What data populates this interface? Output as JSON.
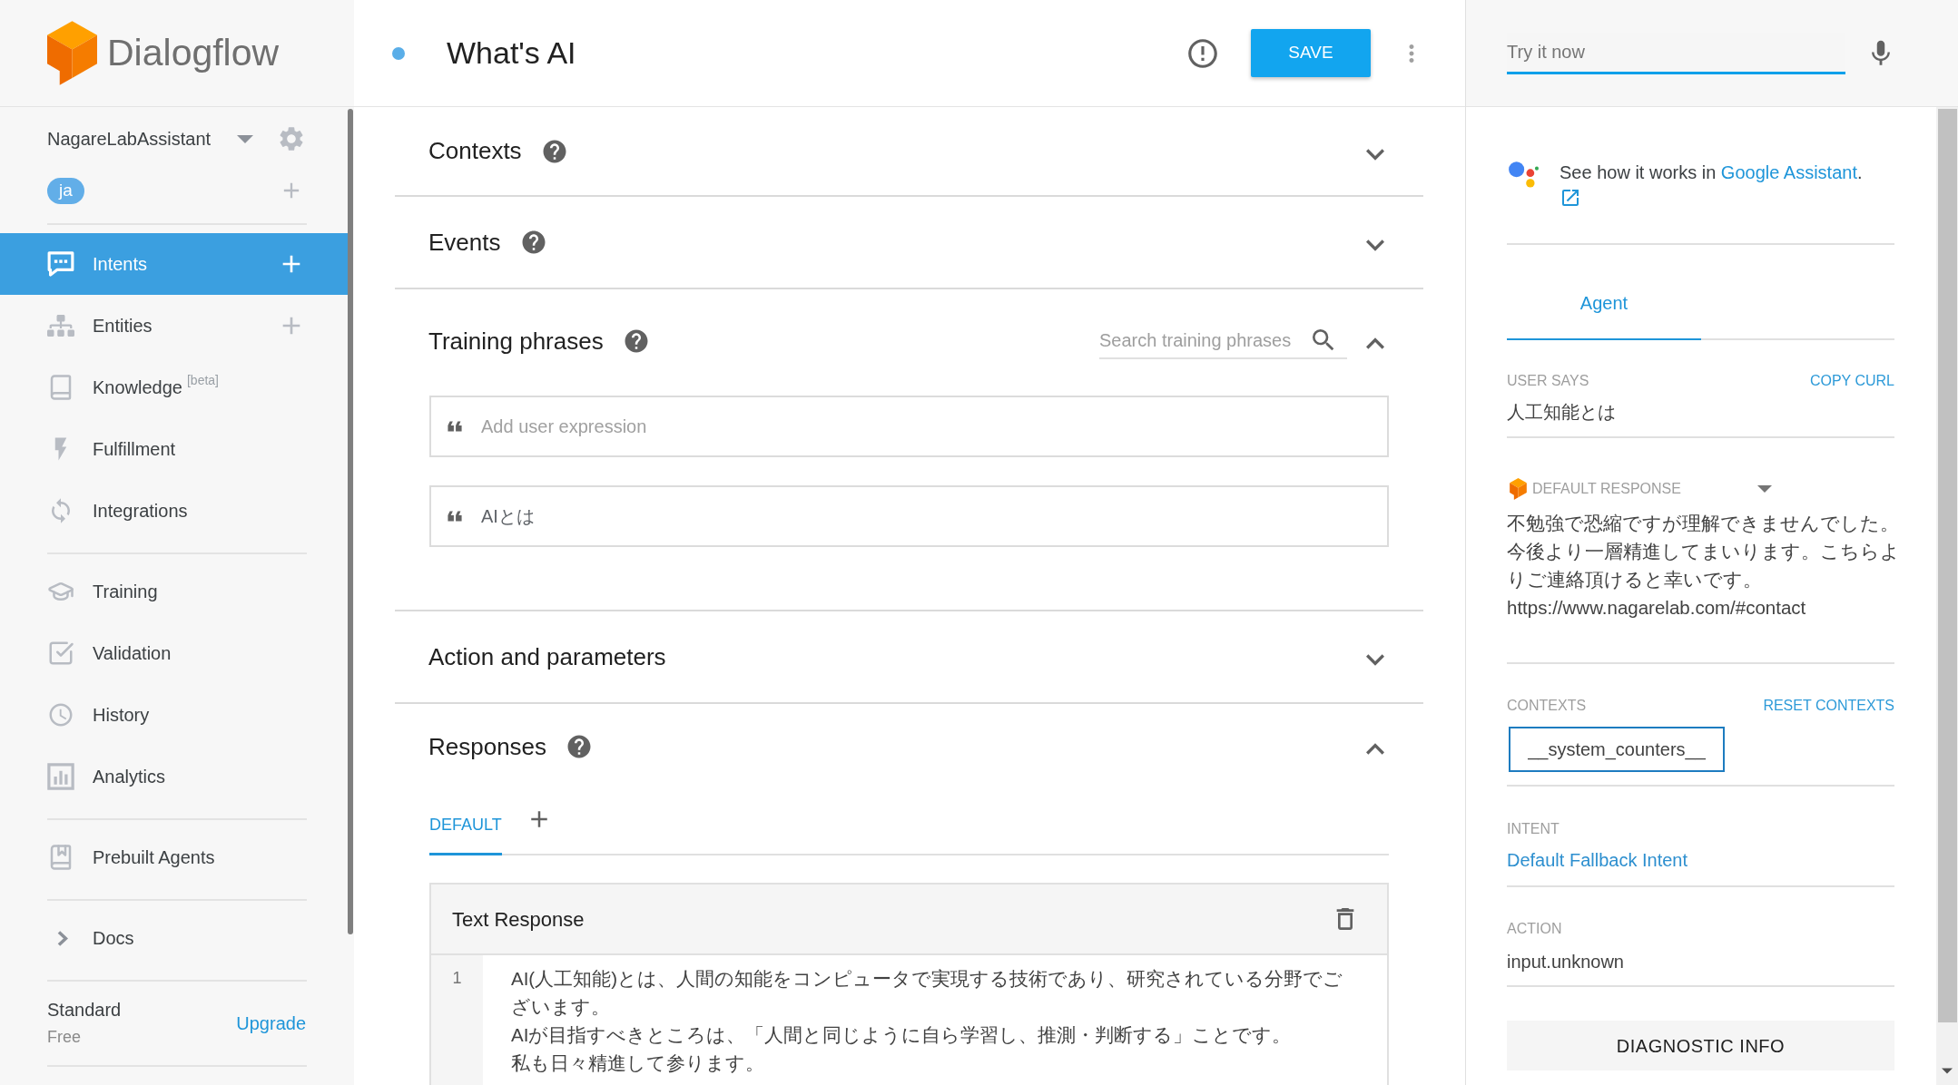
{
  "sidebar": {
    "brand": "Dialogflow",
    "agent": "NagareLabAssistant",
    "language": "ja",
    "nav_groups": [
      {
        "items": [
          {
            "label": "Intents",
            "selected": true,
            "add": true
          },
          {
            "label": "Entities",
            "selected": false,
            "add": true
          },
          {
            "label": "Knowledge",
            "badge": "[beta]",
            "selected": false,
            "add": false
          },
          {
            "label": "Fulfillment",
            "selected": false,
            "add": false
          },
          {
            "label": "Integrations",
            "selected": false,
            "add": false
          }
        ]
      },
      {
        "items": [
          {
            "label": "Training",
            "selected": false,
            "add": false
          },
          {
            "label": "Validation",
            "selected": false,
            "add": false
          },
          {
            "label": "History",
            "selected": false,
            "add": false
          },
          {
            "label": "Analytics",
            "selected": false,
            "add": false
          }
        ]
      },
      {
        "items": [
          {
            "label": "Prebuilt Agents",
            "selected": false,
            "add": false
          }
        ]
      },
      {
        "items": [
          {
            "label": "Docs",
            "selected": false,
            "add": false
          }
        ]
      }
    ],
    "plan": {
      "name": "Standard",
      "tier": "Free",
      "upgrade": "Upgrade"
    }
  },
  "intent": {
    "title": "What's AI",
    "save": "SAVE"
  },
  "sections": [
    {
      "kind": "collapsible",
      "title": "Contexts",
      "help": true,
      "expanded": false
    },
    {
      "kind": "collapsible",
      "title": "Events",
      "help": true,
      "expanded": false
    },
    {
      "kind": "training",
      "title": "Training phrases",
      "help": true,
      "expanded": true,
      "search": {
        "placeholder": "Search training phrases"
      },
      "new_phrase": {
        "placeholder": "Add user expression"
      },
      "phrases": [
        "AIとは"
      ]
    },
    {
      "kind": "collapsible",
      "title": "Action and parameters",
      "help": false,
      "expanded": false
    },
    {
      "kind": "responses",
      "title": "Responses",
      "help": true,
      "expanded": true,
      "tabs": [
        {
          "label": "DEFAULT",
          "selected": true
        }
      ],
      "cards": [
        {
          "title": "Text Response",
          "rows": [
            {
              "number": "1",
              "lines": [
                "AI(人工知能)とは、人間の知能をコンピュータで実現する技術であり、研究されている分野でございます。",
                "AIが目指すべきところは、「人間と同じように自ら学習し、推測・判断する」ことです。",
                "私も日々精進して参ります。"
              ]
            }
          ]
        }
      ]
    }
  ],
  "test_console": {
    "input": {
      "placeholder": "Try it now"
    },
    "assistant_note": {
      "text": "See how it works in",
      "link": "Google Assistant",
      "end": "."
    },
    "tabs": [
      {
        "label": "Agent",
        "selected": true
      }
    ],
    "user_says": {
      "label": "USER SAYS",
      "action": "COPY CURL",
      "value": "人工知能とは"
    },
    "default_response": {
      "label": "DEFAULT RESPONSE",
      "lines": [
        "不勉強で恐縮ですが理解できませんでした。今後より一層精進してまいります。こちらよりご連絡頂けると幸いです。",
        "https://www.nagarelab.com/#contact"
      ]
    },
    "contexts": {
      "label": "CONTEXTS",
      "action": "RESET CONTEXTS",
      "items": [
        "__system_counters__"
      ]
    },
    "intent": {
      "label": "INTENT",
      "value": "Default Fallback Intent"
    },
    "action": {
      "label": "ACTION",
      "value": "input.unknown"
    },
    "diagnostic": "DIAGNOSTIC INFO"
  }
}
